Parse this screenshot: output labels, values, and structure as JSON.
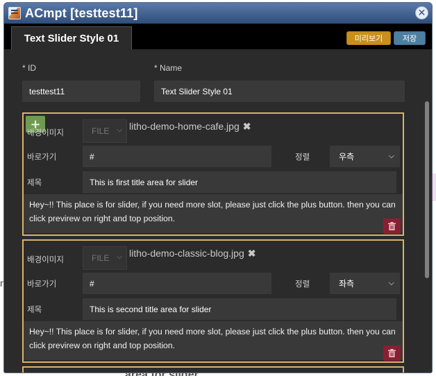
{
  "window": {
    "title": "ACmpt [testtest11]",
    "close_symbol": "✕"
  },
  "tabs": [
    {
      "label": "Text Slider Style 01"
    }
  ],
  "toolbar": {
    "preview_label": "미리보기",
    "save_label": "저장"
  },
  "form": {
    "id_label": "* ID",
    "id_value": "testtest11",
    "name_label": "* Name",
    "name_value": "Text Slider Style 01"
  },
  "slides": [
    {
      "bg_image_label": "배경이미지",
      "file_button": "FILE",
      "file_name": "litho-demo-home-cafe.jpg",
      "remove_symbol": "✖",
      "link_label": "바로가기",
      "link_value": "#",
      "align_label": "정렬",
      "align_value": "우측",
      "title_label": "제목",
      "title_value": "This is first title area for slider",
      "description": "Hey~!! This place is for slider, if you need more slot, please just click the plus button. then you can click previrew on right and top position."
    },
    {
      "bg_image_label": "배경이미지",
      "file_button": "FILE",
      "file_name": "litho-demo-classic-blog.jpg",
      "remove_symbol": "✖",
      "link_label": "바로가기",
      "link_value": "#",
      "align_label": "정렬",
      "align_value": "좌측",
      "title_label": "제목",
      "title_value": "This is second title area for slider",
      "description": "Hey~!! This place is for slider, if you need more slot, please just click the plus button. then you can click previrew on right and top position."
    }
  ],
  "add_symbol": "+",
  "background_fragments": {
    "left": "n",
    "bottom": "area for slider"
  },
  "colors": {
    "title_bar": "#3f5f8f",
    "slot_border": "#d9b36c",
    "preview_button": "#c98f1e",
    "save_button": "#4d7fa0",
    "add_button": "#6f9a52",
    "delete_button": "#8a1f32"
  },
  "icons": {
    "app": "app-window-icon",
    "close": "close-icon",
    "add": "plus-icon",
    "delete": "trash-icon",
    "dropdown": "chevron-down-icon"
  }
}
